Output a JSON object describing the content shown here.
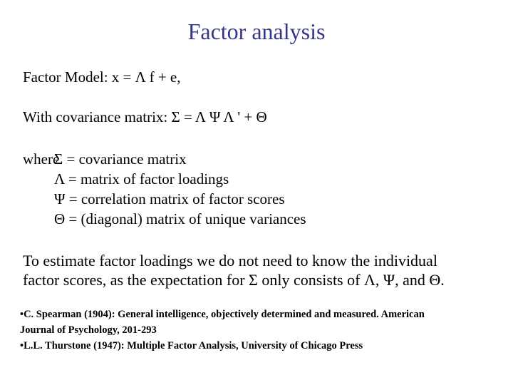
{
  "slide": {
    "title": "Factor analysis",
    "title_color": "#333399",
    "model_line": "Factor Model: x = Λ f + e,",
    "covariance_line": "With covariance matrix: Σ = Λ Ψ Λ ' + Θ",
    "definitions": {
      "lead": "where",
      "items": [
        "Σ = covariance matrix",
        "Λ = matrix of factor loadings",
        "Ψ = correlation matrix of factor scores",
        "Θ = (diagonal) matrix of unique variances"
      ]
    },
    "paragraph": [
      "To estimate factor loadings we do not need to know the individual",
      "factor scores, as the expectation for Σ only consists of Λ, Ψ, and Θ."
    ],
    "references": [
      "•C. Spearman (1904): General intelligence, objectively determined and measured. American",
      "Journal of Psychology, 201-293",
      "•L.L. Thurstone (1947): Multiple Factor Analysis, University of Chicago Press"
    ]
  }
}
